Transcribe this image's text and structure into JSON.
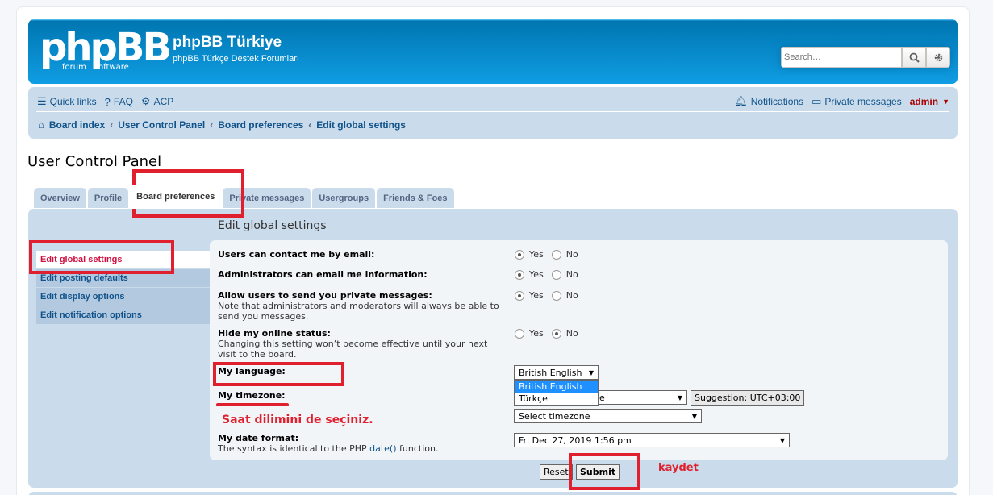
{
  "header": {
    "logo_text": "phpBB",
    "logo_sub_left": "forum",
    "logo_sub_right": "software",
    "site_title": "phpBB Türkiye",
    "site_description": "phpBB Türkçe Destek Forumları",
    "search_placeholder": "Search…"
  },
  "navbar": {
    "quick_links": "Quick links",
    "faq": "FAQ",
    "acp": "ACP",
    "notifications": "Notifications",
    "private_messages": "Private messages",
    "username": "admin"
  },
  "breadcrumb": {
    "items": [
      "Board index",
      "User Control Panel",
      "Board preferences",
      "Edit global settings"
    ]
  },
  "page_title": "User Control Panel",
  "tabs": [
    {
      "label": "Overview"
    },
    {
      "label": "Profile"
    },
    {
      "label": "Board preferences"
    },
    {
      "label": "Private messages"
    },
    {
      "label": "Usergroups"
    },
    {
      "label": "Friends & Foes"
    }
  ],
  "side_menu": [
    {
      "label": "Edit global settings"
    },
    {
      "label": "Edit posting defaults"
    },
    {
      "label": "Edit display options"
    },
    {
      "label": "Edit notification options"
    }
  ],
  "section_title": "Edit global settings",
  "settings": {
    "contact_email": {
      "label": "Users can contact me by email:",
      "yes": "Yes",
      "no": "No",
      "value": "Yes"
    },
    "admin_email": {
      "label": "Administrators can email me information:",
      "yes": "Yes",
      "no": "No",
      "value": "Yes"
    },
    "allow_pm": {
      "label": "Allow users to send you private messages:",
      "explain": "Note that administrators and moderators will always be able to send you messages.",
      "yes": "Yes",
      "no": "No",
      "value": "Yes"
    },
    "hide_online": {
      "label": "Hide my online status:",
      "explain": "Changing this setting won’t become effective until your next visit to the board.",
      "yes": "Yes",
      "no": "No",
      "value": "No"
    },
    "language": {
      "label": "My language:",
      "selected": "British English",
      "options": [
        "British English",
        "Türkçe"
      ]
    },
    "timezone": {
      "label": "My timezone:",
      "partial_value": "e",
      "suggestion": "Suggestion: UTC+03:00",
      "select_placeholder": "Select timezone"
    },
    "date_format": {
      "label": "My date format:",
      "explain_prefix": "The syntax is identical to the PHP ",
      "explain_link": "date()",
      "explain_suffix": " function.",
      "value": "Fri Dec 27, 2019 1:56 pm"
    }
  },
  "buttons": {
    "reset": "Reset",
    "submit": "Submit"
  },
  "annotations": {
    "timezone_note": "Saat dilimini de seçiniz.",
    "submit_note": "kaydet"
  },
  "colors": {
    "header_blue": "#12a3eb",
    "nav_bg": "#cadceb",
    "annotation_red": "#e0202e",
    "link": "#105289"
  }
}
